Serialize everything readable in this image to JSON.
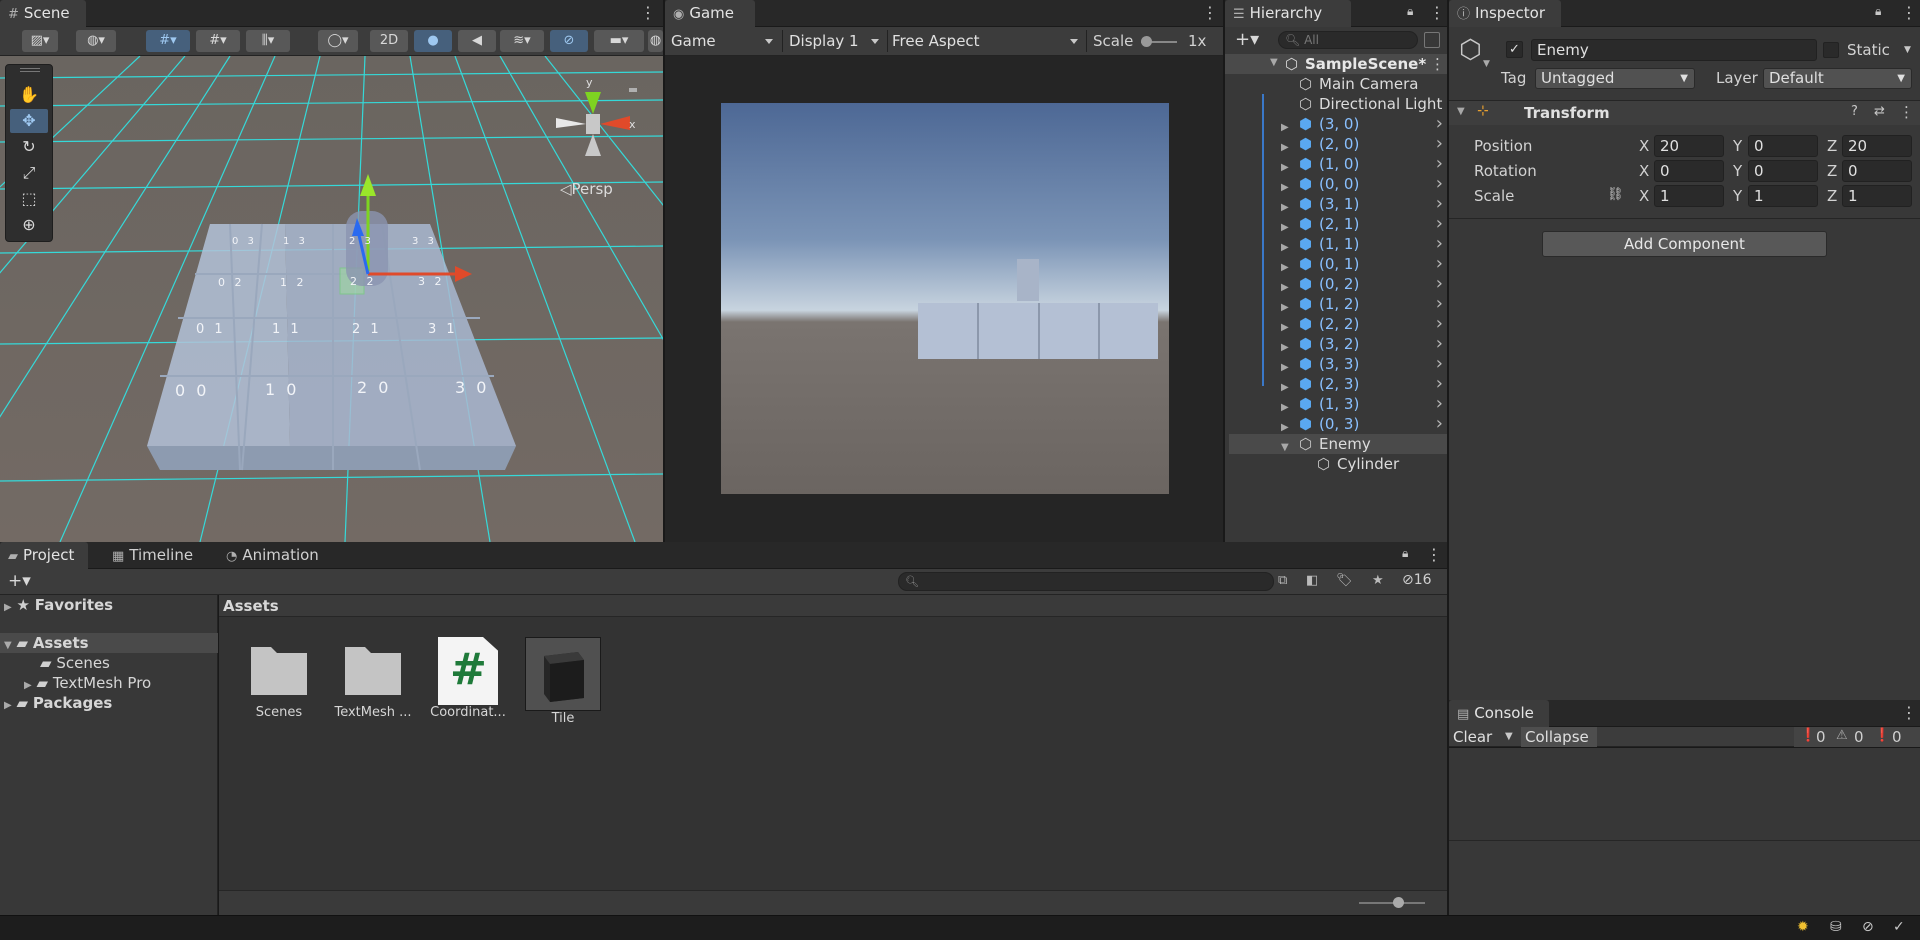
{
  "scene": {
    "tab_label": "Scene",
    "btn_2d": "2D",
    "persp_label": "◁Persp",
    "gizmo_y": "y",
    "gizmo_x": "x",
    "tiles": [
      {
        "label": "0 3"
      },
      {
        "label": "1 3"
      },
      {
        "label": "2 3"
      },
      {
        "label": "3 3"
      },
      {
        "label": "0 2"
      },
      {
        "label": "1 2"
      },
      {
        "label": "2 2"
      },
      {
        "label": "3 2"
      },
      {
        "label": "0 1"
      },
      {
        "label": "1 1"
      },
      {
        "label": "2 1"
      },
      {
        "label": "3 1"
      },
      {
        "label": "0 0"
      },
      {
        "label": "1 0"
      },
      {
        "label": "2 0"
      },
      {
        "label": "3 0"
      }
    ]
  },
  "game": {
    "tab_label": "Game",
    "mode": "Game",
    "display": "Display 1",
    "aspect": "Free Aspect",
    "scale_label": "Scale",
    "scale_value": "1x"
  },
  "hierarchy": {
    "tab_label": "Hierarchy",
    "search_placeholder": "All",
    "scene_name": "SampleScene*",
    "items": [
      {
        "name": "Main Camera",
        "prefab": false
      },
      {
        "name": "Directional Light",
        "prefab": false
      },
      {
        "name": "(3, 0)",
        "prefab": true
      },
      {
        "name": "(2, 0)",
        "prefab": true
      },
      {
        "name": "(1, 0)",
        "prefab": true
      },
      {
        "name": "(0, 0)",
        "prefab": true
      },
      {
        "name": "(3, 1)",
        "prefab": true
      },
      {
        "name": "(2, 1)",
        "prefab": true
      },
      {
        "name": "(1, 1)",
        "prefab": true
      },
      {
        "name": "(0, 1)",
        "prefab": true
      },
      {
        "name": "(0, 2)",
        "prefab": true
      },
      {
        "name": "(1, 2)",
        "prefab": true
      },
      {
        "name": "(2, 2)",
        "prefab": true
      },
      {
        "name": "(3, 2)",
        "prefab": true
      },
      {
        "name": "(3, 3)",
        "prefab": true
      },
      {
        "name": "(2, 3)",
        "prefab": true
      },
      {
        "name": "(1, 3)",
        "prefab": true
      },
      {
        "name": "(0, 3)",
        "prefab": true
      },
      {
        "name": "Enemy",
        "prefab": false
      },
      {
        "name": "Cylinder",
        "prefab": false
      }
    ]
  },
  "inspector": {
    "tab_label": "Inspector",
    "object_name": "Enemy",
    "static_label": "Static",
    "tag_label": "Tag",
    "tag_value": "Untagged",
    "layer_label": "Layer",
    "layer_value": "Default",
    "transform_label": "Transform",
    "position_label": "Position",
    "rotation_label": "Rotation",
    "scale_label": "Scale",
    "axis_x": "X",
    "axis_y": "Y",
    "axis_z": "Z",
    "position": {
      "x": "20",
      "y": "0",
      "z": "20"
    },
    "rotation": {
      "x": "0",
      "y": "0",
      "z": "0"
    },
    "scale": {
      "x": "1",
      "y": "1",
      "z": "1"
    },
    "add_component": "Add Component"
  },
  "project": {
    "tabs": {
      "project": "Project",
      "timeline": "Timeline",
      "animation": "Animation"
    },
    "visible_count": "16",
    "favorites": "Favorites",
    "assets": "Assets",
    "scenes": "Scenes",
    "textmesh": "TextMesh Pro",
    "packages": "Packages",
    "breadcrumb": "Assets",
    "grid_items": [
      {
        "label": "Scenes"
      },
      {
        "label": "TextMesh ..."
      },
      {
        "label": "Coordinat..."
      },
      {
        "label": "Tile"
      }
    ],
    "script_glyph": "#"
  },
  "console": {
    "tab_label": "Console",
    "clear": "Clear",
    "collapse": "Collapse",
    "info_count": "0",
    "warn_count": "0",
    "error_count": "0"
  },
  "colors": {
    "accent_blue": "#46607c",
    "prefab_text": "#8ac0ff",
    "grid_cyan": "#2fe6e6",
    "ground": "#736a64"
  }
}
